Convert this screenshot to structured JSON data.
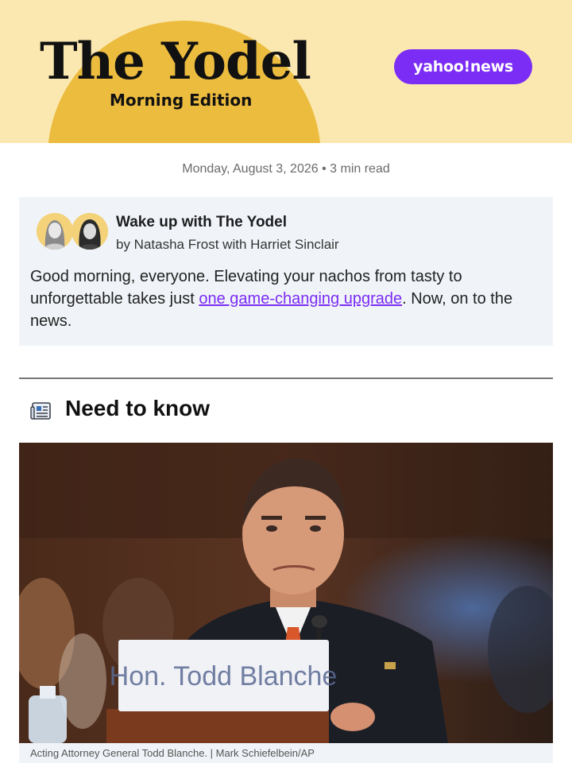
{
  "header": {
    "title": "The Yodel",
    "subtitle": "Morning Edition",
    "brand": "yahoo!news",
    "colors": {
      "banner": "#fbe8b0",
      "sun": "#ecbc3f",
      "brand": "#7b2cf5"
    }
  },
  "dateline": "Monday, August 3, 2026 • 3 min read",
  "intro": {
    "heading": "Wake up with The Yodel",
    "byline": "by Natasha Frost with Harriet Sinclair",
    "text_before_link": "Good morning, everyone. Elevating your nachos from tasty to unforgettable takes just ",
    "link_text": "one game-changing upgrade",
    "text_after_link": ". Now, on to the news.",
    "avatars": [
      "author-avatar",
      "author-avatar"
    ]
  },
  "section": {
    "title": "Need to know",
    "icon": "newspaper-icon"
  },
  "photo": {
    "placard_text": "Hon. Todd Blanche",
    "caption": "Acting Attorney General Todd Blanche. | Mark Schiefelbein/AP"
  }
}
